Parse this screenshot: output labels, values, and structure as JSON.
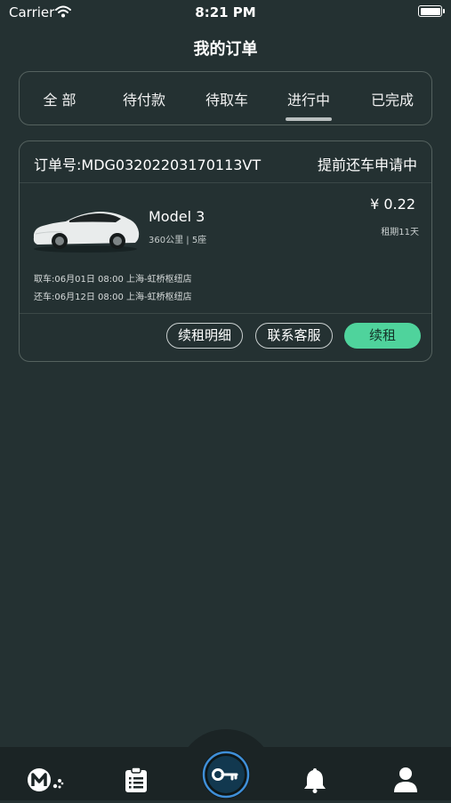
{
  "status_bar": {
    "carrier": "Carrier",
    "time": "8:21 PM"
  },
  "header": {
    "title": "我的订单"
  },
  "tabs": [
    {
      "label": "全 部"
    },
    {
      "label": "待付款"
    },
    {
      "label": "待取车"
    },
    {
      "label": "进行中",
      "active": true
    },
    {
      "label": "已完成"
    }
  ],
  "order": {
    "number": "订单号:MDG03202203170113VT",
    "status": "提前还车申请中",
    "car_model": "Model 3",
    "car_specs": "360公里 | 5座",
    "price": "¥ 0.22",
    "rent_days": "租期11天",
    "pickup": "取车:06月01日 08:00 上海-虹桥枢纽店",
    "return": "还车:06月12日 08:00 上海-虹桥枢纽店",
    "buttons": {
      "renew_detail": "续租明细",
      "contact_service": "联系客服",
      "renew": "续租"
    }
  },
  "bottom_nav": {
    "items": [
      {
        "icon": "brand-logo-icon"
      },
      {
        "icon": "orders-clipboard-icon"
      },
      {
        "icon": "key-icon"
      },
      {
        "icon": "bell-icon"
      },
      {
        "icon": "user-icon"
      }
    ]
  },
  "colors": {
    "background": "#243132",
    "card_border": "#55625f",
    "accent_green": "#4fd39c",
    "tab_bar": "#1b2425"
  }
}
